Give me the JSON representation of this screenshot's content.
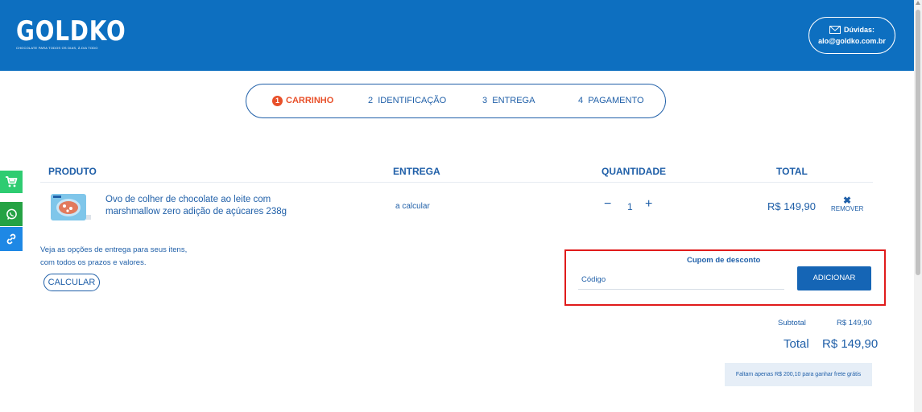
{
  "header": {
    "logo_text": "GOLDKO",
    "logo_tagline": "CHOCOLATE PARA TODOS OS DIAS, À DIA TODO",
    "help_label": "Dúvidas:",
    "help_email": "alo@goldko.com.br",
    "bg_color": "#0d6fc0"
  },
  "steps": [
    {
      "num": "1",
      "label": "CARRINHO",
      "active": true
    },
    {
      "num": "2",
      "label": "IDENTIFICAÇÃO",
      "active": false
    },
    {
      "num": "3",
      "label": "ENTREGA",
      "active": false
    },
    {
      "num": "4",
      "label": "PAGAMENTO",
      "active": false
    }
  ],
  "side_buttons": [
    {
      "icon": "cart-icon",
      "color": "#2ecc71"
    },
    {
      "icon": "whatsapp-icon",
      "color": "#25a244"
    },
    {
      "icon": "link-icon",
      "color": "#1e88e5"
    }
  ],
  "table": {
    "headers": [
      "PRODUTO",
      "ENTREGA",
      "QUANTIDADE",
      "TOTAL"
    ],
    "rows": [
      {
        "product_name": "Ovo de colher de chocolate ao leite com marshmallow zero adição de açúcares 238g",
        "delivery": "a calcular",
        "quantity": "1",
        "total": "R$ 149,90",
        "remove_label": "REMOVER"
      }
    ]
  },
  "shipping": {
    "text_line1": "Veja as opções de entrega para seus itens,",
    "text_line2": "com todos os prazos e valores.",
    "calc_label": "CALCULAR"
  },
  "coupon": {
    "title": "Cupom de desconto",
    "placeholder": "Código",
    "button_label": "ADICIONAR"
  },
  "summary": {
    "subtotal_label": "Subtotal",
    "subtotal_value": "R$ 149,90",
    "total_label": "Total",
    "total_value": "R$ 149,90",
    "free_shipping_text": "Faltam apenas R$  200,10  para ganhar frete grátis"
  }
}
